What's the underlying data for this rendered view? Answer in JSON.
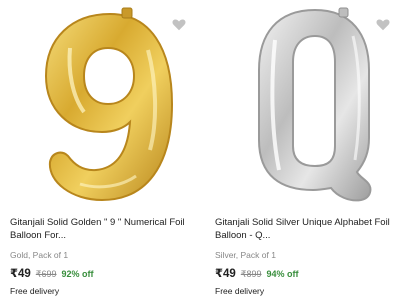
{
  "products": [
    {
      "title_line1": "Gitanjali Solid Golden \" 9 \" Numerical Foil",
      "title_line2": "Balloon For...",
      "variant": "Gold, Pack of 1",
      "price": "₹49",
      "mrp": "₹699",
      "discount": "92% off",
      "delivery": "Free delivery",
      "image_icon": "golden-9-balloon",
      "color": "#d4a72c"
    },
    {
      "title_line1": "Gitanjali Solid Silver Unique Alphabet Foil",
      "title_line2": "Balloon - Q...",
      "variant": "Silver, Pack of 1",
      "price": "₹49",
      "mrp": "₹899",
      "discount": "94% off",
      "delivery": "Free delivery",
      "image_icon": "silver-q-balloon",
      "color": "#c8c8c8"
    }
  ],
  "colors": {
    "discount_green": "#388e3c",
    "muted_gray": "#878787",
    "wishlist_gray": "#c2c2c2"
  }
}
